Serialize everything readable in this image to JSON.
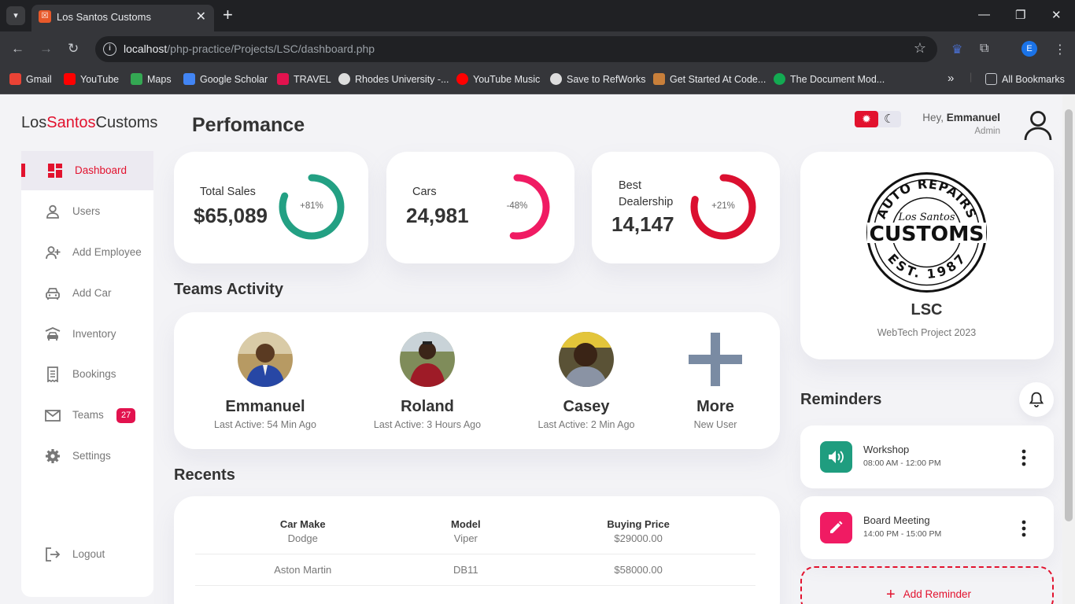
{
  "browser": {
    "tab_title": "Los Santos Customs",
    "url_host": "localhost",
    "url_path": "/php-practice/Projects/LSC/dashboard.php",
    "profile_initial": "E",
    "bookmarks": [
      {
        "label": "Gmail",
        "color": "#ea4335"
      },
      {
        "label": "YouTube",
        "color": "#ff0000"
      },
      {
        "label": "Maps",
        "color": "#34a853"
      },
      {
        "label": "Google Scholar",
        "color": "#4285f4"
      },
      {
        "label": "TRAVEL",
        "color": "#e2124e"
      },
      {
        "label": "Rhodes University -...",
        "color": "#dddddd"
      },
      {
        "label": "YouTube Music",
        "color": "#ff0000"
      },
      {
        "label": "Save to RefWorks",
        "color": "#dddddd"
      },
      {
        "label": "Get Started At Code...",
        "color": "#c87f3a"
      },
      {
        "label": "The Document Mod...",
        "color": "#13aa52"
      }
    ],
    "all_bookmarks": "All Bookmarks"
  },
  "brand": {
    "part1": "Los",
    "part2": "Santos",
    "part3": "Customs",
    "accent": "#e2122e"
  },
  "page_title": "Perfomance",
  "sidebar": {
    "items": [
      {
        "label": "Dashboard",
        "icon": "dashboard-icon"
      },
      {
        "label": "Users",
        "icon": "user-icon"
      },
      {
        "label": "Add Employee",
        "icon": "add-user-icon"
      },
      {
        "label": "Add Car",
        "icon": "car-icon"
      },
      {
        "label": "Inventory",
        "icon": "garage-car-icon"
      },
      {
        "label": "Bookings",
        "icon": "receipt-icon"
      },
      {
        "label": "Teams",
        "icon": "mail-icon",
        "badge": "27"
      },
      {
        "label": "Settings",
        "icon": "gear-icon"
      }
    ],
    "logout": "Logout"
  },
  "stats": [
    {
      "label": "Total Sales",
      "value": "$65,089",
      "percent": "+81%",
      "fill": 0.81,
      "color": "#23a083"
    },
    {
      "label": "Cars",
      "value": "24,981",
      "percent": "-48%",
      "fill": 0.52,
      "color": "#f01b63"
    },
    {
      "label": "Best Dealership",
      "label_line1": "Best",
      "label_line2": "Dealership",
      "value": "14,147",
      "percent": "+21%",
      "fill": 0.79,
      "color": "#db1030"
    }
  ],
  "teams": {
    "title": "Teams Activity",
    "members": [
      {
        "name": "Emmanuel",
        "status": "Last Active: 54 Min Ago"
      },
      {
        "name": "Roland",
        "status": "Last Active: 3 Hours Ago"
      },
      {
        "name": "Casey",
        "status": "Last Active: 2 Min Ago"
      }
    ],
    "more": {
      "name": "More",
      "status": "New User"
    }
  },
  "recents": {
    "title": "Recents",
    "columns": [
      "Car Make",
      "Model",
      "Buying Price"
    ],
    "rows": [
      [
        "Dodge",
        "Viper",
        "$29000.00"
      ],
      [
        "Aston Martin",
        "DB11",
        "$58000.00"
      ]
    ]
  },
  "header": {
    "greeting": "Hey, ",
    "user": "Emmanuel",
    "role": "Admin"
  },
  "profile_card": {
    "title": "LSC",
    "subtitle": "WebTech Project 2023",
    "logo_top": "AUTO REPAIRS",
    "logo_script": "Los Santos",
    "logo_main": "CUSTOMS",
    "logo_bottom": "EST. 1987"
  },
  "reminders": {
    "title": "Reminders",
    "items": [
      {
        "title": "Workshop",
        "time": "08:00 AM - 12:00 PM",
        "color": "#1f9d7f",
        "icon": "speaker-icon"
      },
      {
        "title": "Board Meeting",
        "time": "14:00 PM - 15:00 PM",
        "color": "#f01b63",
        "icon": "pencil-icon"
      }
    ],
    "add_label": "Add Reminder"
  }
}
